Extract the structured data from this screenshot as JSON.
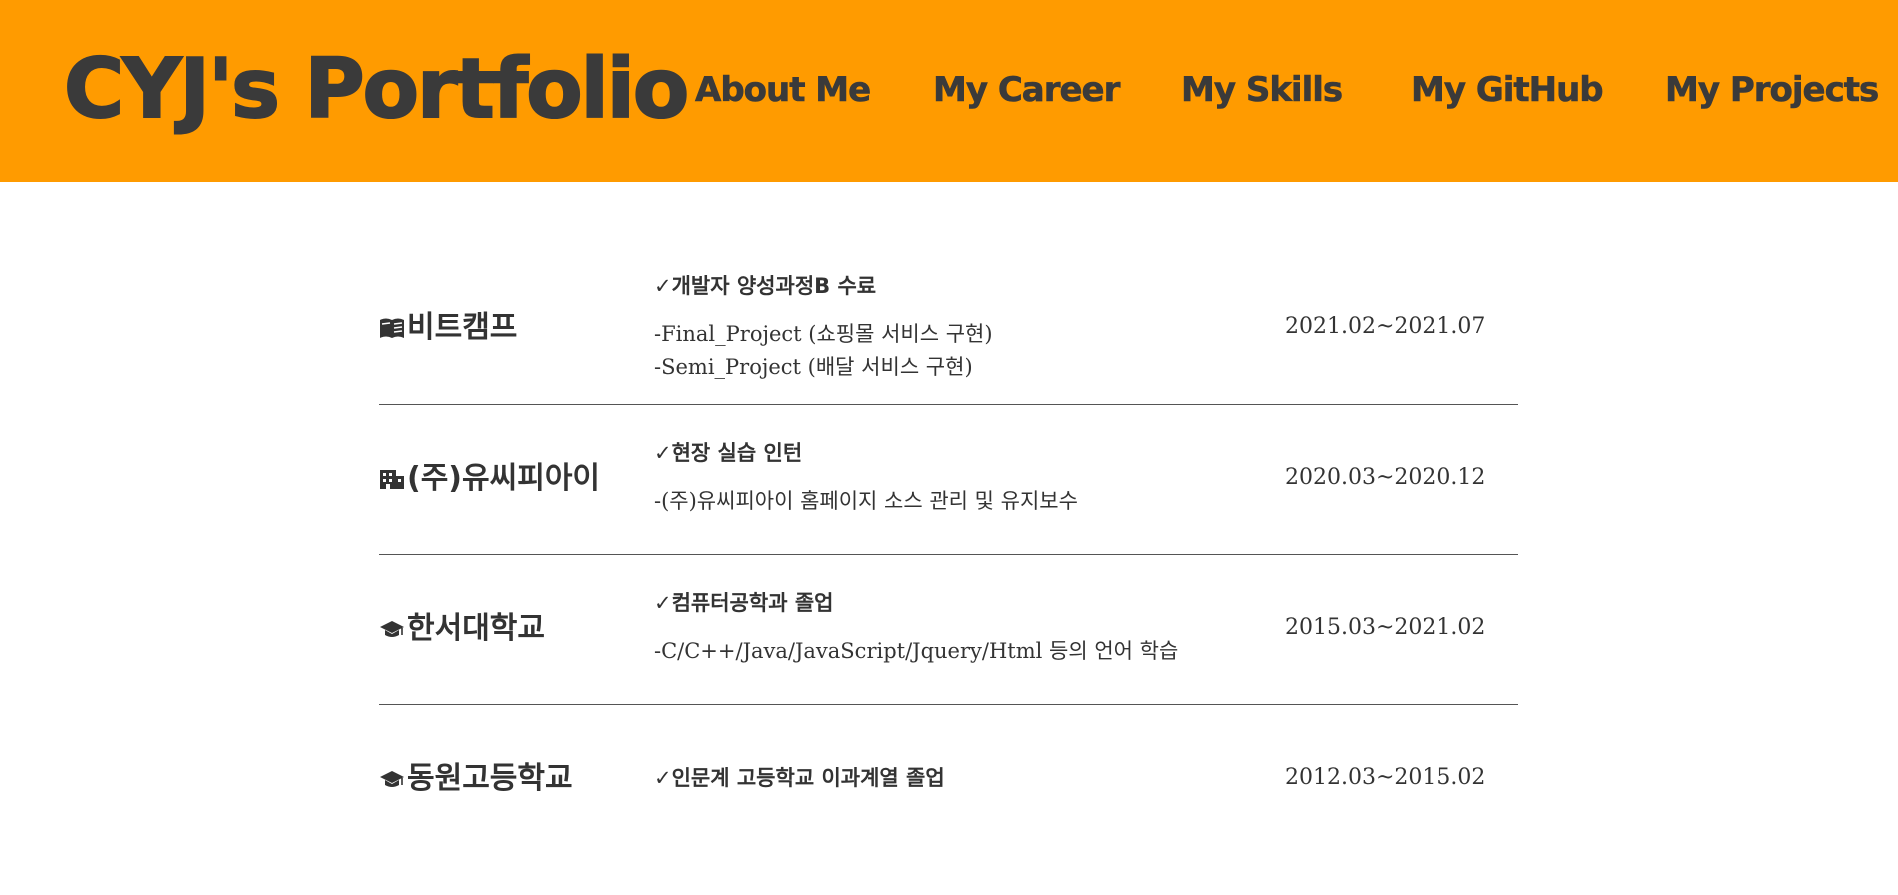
{
  "header": {
    "logo": "CYJ's Portfolio",
    "nav": [
      "About Me",
      "My Career",
      "My Skills",
      "My GitHub",
      "My Projects"
    ],
    "background": "#ff9b00"
  },
  "career": [
    {
      "icon": "book-icon",
      "org": "비트캠프",
      "check": "✓개발자 양성과정B 수료",
      "details": [
        "-Final_Project (쇼핑몰 서비스 구현)",
        "-Semi_Project (배달 서비스 구현)"
      ],
      "period": "2021.02~2021.07"
    },
    {
      "icon": "building-icon",
      "org": "(주)유씨피아이",
      "check": "✓현장 실습 인턴",
      "details": [
        "-(주)유씨피아이 홈페이지 소스 관리 및 유지보수"
      ],
      "period": "2020.03~2020.12"
    },
    {
      "icon": "graduation-cap-icon",
      "org": "한서대학교",
      "check": "✓컴퓨터공학과 졸업",
      "details": [
        "-C/C++/Java/JavaScript/Jquery/Html 등의 언어 학습"
      ],
      "period": "2015.03~2021.02"
    },
    {
      "icon": "graduation-cap-icon",
      "org": "동원고등학교",
      "check": "✓인문계 고등학교 이과계열 졸업",
      "details": [],
      "period": "2012.03~2015.02"
    }
  ]
}
